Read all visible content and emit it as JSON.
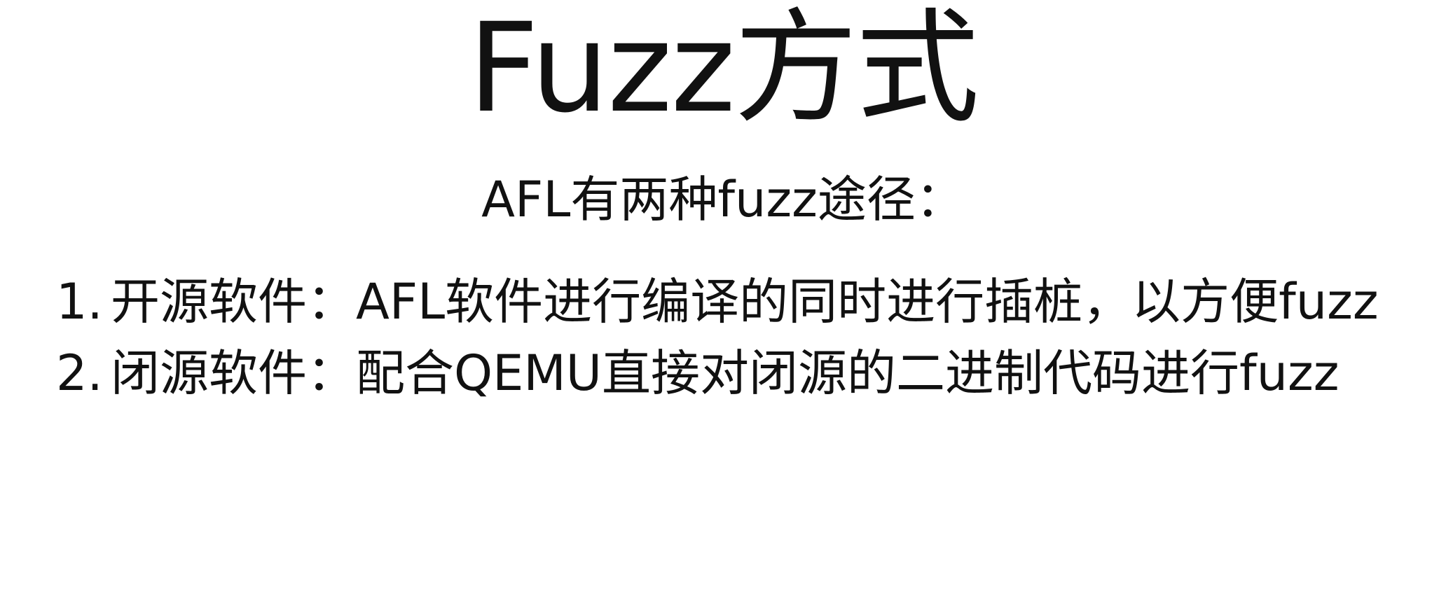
{
  "slide": {
    "title": "Fuzz方式",
    "subtitle": "AFL有两种fuzz途径：",
    "items": [
      {
        "number": "1.",
        "text": "开源软件：AFL软件进行编译的同时进行插桩，以方便fuzz"
      },
      {
        "number": "2.",
        "text": "闭源软件：配合QEMU直接对闭源的二进制代码进行fuzz"
      }
    ]
  }
}
